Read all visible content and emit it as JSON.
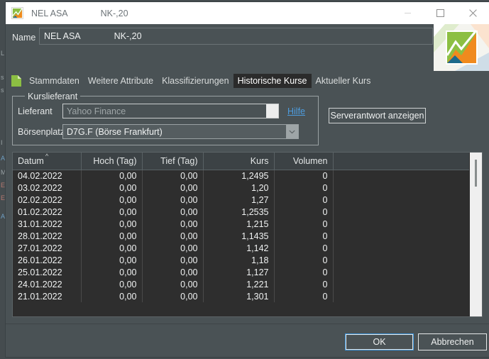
{
  "window": {
    "title_name": "NEL ASA",
    "title_sub": "NK-,20",
    "icon": "chart-app-icon",
    "controls": {
      "minimize": "minimize-icon",
      "maximize": "maximize-icon",
      "close": "close-icon"
    }
  },
  "header": {
    "name_label": "Name",
    "name_value": "NEL ASA",
    "name_value_sub": "NK-,20",
    "logo": "security-chart-logo"
  },
  "tabs": {
    "doc_icon": "document-icon",
    "items": [
      {
        "label": "Stammdaten",
        "active": false
      },
      {
        "label": "Weitere Attribute",
        "active": false
      },
      {
        "label": "Klassifizierungen",
        "active": false
      },
      {
        "label": "Historische Kurse",
        "active": true
      },
      {
        "label": "Aktueller Kurs",
        "active": false
      }
    ]
  },
  "kurslieferant": {
    "legend": "Kurslieferant",
    "lieferant_label": "Lieferant",
    "lieferant_value": "Yahoo Finance",
    "hilfe_link": "Hilfe",
    "boersenplatz_label": "Börsenplatz",
    "boersenplatz_value": "D7G.F (Börse Frankfurt)",
    "dropdown_arrow": "chevron-down-icon",
    "server_button": "Serverantwort anzeigen"
  },
  "table": {
    "sort_column": "Datum",
    "sort_direction": "ascending",
    "sort_caret": "^",
    "columns": [
      "Datum",
      "Hoch (Tag)",
      "Tief (Tag)",
      "Kurs",
      "Volumen",
      ""
    ],
    "rows": [
      [
        "04.02.2022",
        "0,00",
        "0,00",
        "1,2495",
        "0",
        ""
      ],
      [
        "03.02.2022",
        "0,00",
        "0,00",
        "1,20",
        "0",
        ""
      ],
      [
        "02.02.2022",
        "0,00",
        "0,00",
        "1,27",
        "0",
        ""
      ],
      [
        "01.02.2022",
        "0,00",
        "0,00",
        "1,2535",
        "0",
        ""
      ],
      [
        "31.01.2022",
        "0,00",
        "0,00",
        "1,215",
        "0",
        ""
      ],
      [
        "28.01.2022",
        "0,00",
        "0,00",
        "1,1435",
        "0",
        ""
      ],
      [
        "27.01.2022",
        "0,00",
        "0,00",
        "1,142",
        "0",
        ""
      ],
      [
        "26.01.2022",
        "0,00",
        "0,00",
        "1,18",
        "0",
        ""
      ],
      [
        "25.01.2022",
        "0,00",
        "0,00",
        "1,127",
        "0",
        ""
      ],
      [
        "24.01.2022",
        "0,00",
        "0,00",
        "1,221",
        "0",
        ""
      ],
      [
        "21.01.2022",
        "0,00",
        "0,00",
        "1,301",
        "0",
        ""
      ]
    ]
  },
  "footer": {
    "ok_label": "OK",
    "cancel_label": "Abbrechen"
  },
  "colors": {
    "window_bg": "#4a5255",
    "titlebar_bg": "#ffffff",
    "table_bg": "#2e2e2e",
    "table_header_bg": "#3c4245",
    "accent_focus": "#3b92d8",
    "link": "#4d9de0",
    "active_tab_bg": "#2b2b2b",
    "logo_green": "#8cbf43",
    "logo_orange": "#f08a1e",
    "logo_blue": "#1d6a8c"
  },
  "background_fragments": [
    "L",
    "s",
    "s",
    "I",
    "A",
    "M",
    "E",
    "E",
    "A"
  ]
}
